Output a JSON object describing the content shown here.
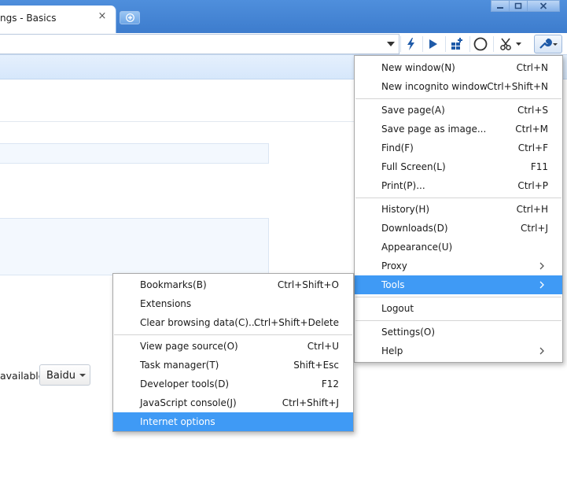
{
  "tab": {
    "title": "ngs - Basics",
    "close_glyph": "×"
  },
  "toolbar": {
    "icons": [
      "dropdown-arrow-icon",
      "lightning-icon",
      "play-icon",
      "apps-plus-icon",
      "circle-icon",
      "scissors-icon",
      "wrench-icon"
    ]
  },
  "page": {
    "available_label": "available",
    "search_engine_value": "Baidu"
  },
  "main_menu": {
    "items": [
      {
        "label": "New window(N)",
        "shortcut": "Ctrl+N"
      },
      {
        "label": "New incognito window",
        "shortcut": "Ctrl+Shift+N"
      },
      {
        "label": "Save page(A)",
        "shortcut": "Ctrl+S"
      },
      {
        "label": "Save page as image...",
        "shortcut": "Ctrl+M"
      },
      {
        "label": "Find(F)",
        "shortcut": "Ctrl+F"
      },
      {
        "label": "Full Screen(L)",
        "shortcut": "F11"
      },
      {
        "label": "Print(P)...",
        "shortcut": "Ctrl+P"
      },
      {
        "label": "History(H)",
        "shortcut": "Ctrl+H"
      },
      {
        "label": "Downloads(D)",
        "shortcut": "Ctrl+J"
      },
      {
        "label": "Appearance(U)",
        "shortcut": ""
      },
      {
        "label": "Proxy",
        "shortcut": ""
      },
      {
        "label": "Tools",
        "shortcut": ""
      },
      {
        "label": "Logout",
        "shortcut": ""
      },
      {
        "label": "Settings(O)",
        "shortcut": ""
      },
      {
        "label": "Help",
        "shortcut": ""
      }
    ],
    "highlighted": "Tools"
  },
  "tools_submenu": {
    "items": [
      {
        "label": "Bookmarks(B)",
        "shortcut": "Ctrl+Shift+O"
      },
      {
        "label": "Extensions",
        "shortcut": ""
      },
      {
        "label": "Clear browsing data(C)...",
        "shortcut": "Ctrl+Shift+Delete"
      },
      {
        "label": "View page source(O)",
        "shortcut": "Ctrl+U"
      },
      {
        "label": "Task manager(T)",
        "shortcut": "Shift+Esc"
      },
      {
        "label": "Developer tools(D)",
        "shortcut": "F12"
      },
      {
        "label": "JavaScript console(J)",
        "shortcut": "Ctrl+Shift+J"
      },
      {
        "label": "Internet options",
        "shortcut": ""
      }
    ],
    "highlighted": "Internet options"
  },
  "colors": {
    "titlebar": "#3d7ccd",
    "menu_highlight": "#3f9af5",
    "infobar": "#dbe9fb"
  }
}
